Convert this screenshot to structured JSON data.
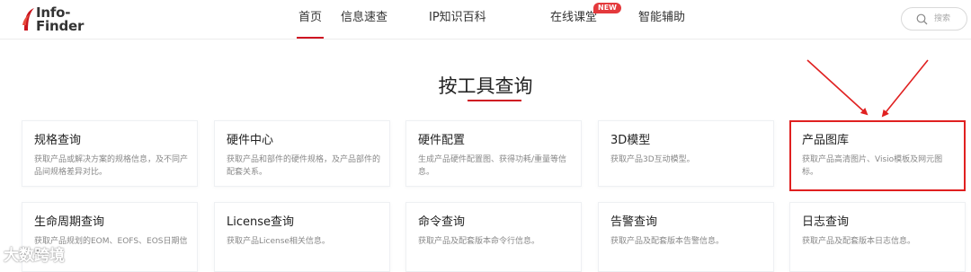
{
  "header": {
    "logo_line1": "Info-",
    "logo_line2": "Finder",
    "nav": [
      {
        "label": "首页",
        "active": true
      },
      {
        "label": "信息速查"
      },
      {
        "label": "IP知识百科"
      },
      {
        "label": "在线课堂",
        "badge": "NEW"
      },
      {
        "label": "智能辅助"
      }
    ],
    "search_placeholder": "搜索"
  },
  "section": {
    "title": "按工具查询"
  },
  "cards": [
    {
      "title": "规格查询",
      "desc": "获取产品或解决方案的规格信息，及不同产品间规格差异对比。"
    },
    {
      "title": "硬件中心",
      "desc": "获取产品和部件的硬件规格，及产品部件的配套关系。"
    },
    {
      "title": "硬件配置",
      "desc": "生成产品硬件配置图、获得功耗/重量等信息。"
    },
    {
      "title": "3D模型",
      "desc": "获取产品3D互动模型。"
    },
    {
      "title": "产品图库",
      "desc": "获取产品高清图片、Visio模板及网元图标。",
      "highlighted": true
    },
    {
      "title": "生命周期查询",
      "desc": "获取产品规划的EOM、EOFS、EOS日期信息。"
    },
    {
      "title": "License查询",
      "desc": "获取产品License相关信息。"
    },
    {
      "title": "命令查询",
      "desc": "获取产品及配套版本命令行信息。"
    },
    {
      "title": "告警查询",
      "desc": "获取产品及配套版本告警信息。"
    },
    {
      "title": "日志查询",
      "desc": "获取产品及配套版本日志信息。"
    }
  ],
  "annotation": {
    "arrow_color": "#e02020"
  },
  "watermark": "大数跨境",
  "colors": {
    "accent": "#cf1322",
    "badge": "#e4393c",
    "highlight_border": "#e02020"
  }
}
